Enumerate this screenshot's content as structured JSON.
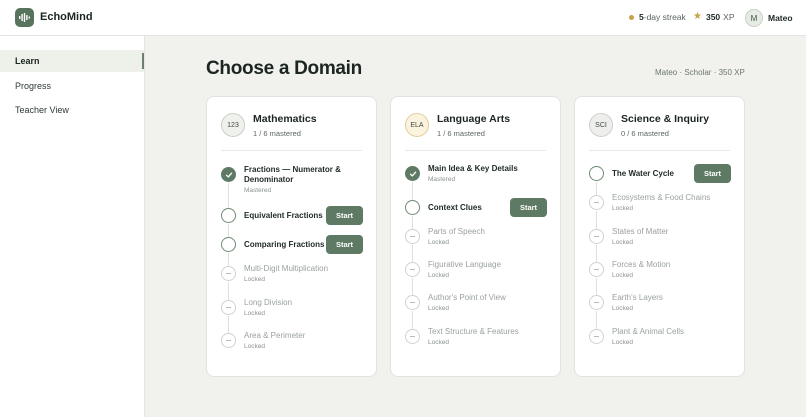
{
  "app": {
    "name": "EchoMind"
  },
  "header": {
    "streak_num": "5",
    "streak_text": "-day streak",
    "xp_num": "350",
    "xp_text": "XP",
    "avatar_initial": "M",
    "username": "Mateo"
  },
  "sidebar": {
    "items": [
      {
        "label": "Learn"
      },
      {
        "label": "Progress"
      },
      {
        "label": "Teacher View"
      }
    ]
  },
  "main": {
    "title": "Choose a Domain",
    "subtitle": "Mateo · Scholar · 350 XP"
  },
  "start_label": "Start",
  "colors": {
    "accent": "#5e7a64",
    "streak": "#c6a24a",
    "background": "#f1f2ee"
  },
  "domains": [
    {
      "badge": "123",
      "title": "Mathematics",
      "mastered": "1 / 6 mastered",
      "topics": [
        {
          "name": "Fractions — Numerator & Denominator",
          "status": "Mastered",
          "state": "mastered"
        },
        {
          "name": "Equivalent Fractions",
          "status": "",
          "state": "available"
        },
        {
          "name": "Comparing Fractions",
          "status": "",
          "state": "available"
        },
        {
          "name": "Multi-Digit Multiplication",
          "status": "Locked",
          "state": "locked"
        },
        {
          "name": "Long Division",
          "status": "Locked",
          "state": "locked"
        },
        {
          "name": "Area & Perimeter",
          "status": "Locked",
          "state": "locked"
        }
      ]
    },
    {
      "badge": "ELA",
      "title": "Language Arts",
      "mastered": "1 / 6 mastered",
      "topics": [
        {
          "name": "Main Idea & Key Details",
          "status": "Mastered",
          "state": "mastered"
        },
        {
          "name": "Context Clues",
          "status": "",
          "state": "available"
        },
        {
          "name": "Parts of Speech",
          "status": "Locked",
          "state": "locked"
        },
        {
          "name": "Figurative Language",
          "status": "Locked",
          "state": "locked"
        },
        {
          "name": "Author's Point of View",
          "status": "Locked",
          "state": "locked"
        },
        {
          "name": "Text Structure & Features",
          "status": "Locked",
          "state": "locked"
        }
      ]
    },
    {
      "badge": "SCI",
      "title": "Science & Inquiry",
      "mastered": "0 / 6 mastered",
      "topics": [
        {
          "name": "The Water Cycle",
          "status": "",
          "state": "available"
        },
        {
          "name": "Ecosystems & Food Chains",
          "status": "Locked",
          "state": "locked"
        },
        {
          "name": "States of Matter",
          "status": "Locked",
          "state": "locked"
        },
        {
          "name": "Forces & Motion",
          "status": "Locked",
          "state": "locked"
        },
        {
          "name": "Earth's Layers",
          "status": "Locked",
          "state": "locked"
        },
        {
          "name": "Plant & Animal Cells",
          "status": "Locked",
          "state": "locked"
        }
      ]
    }
  ]
}
